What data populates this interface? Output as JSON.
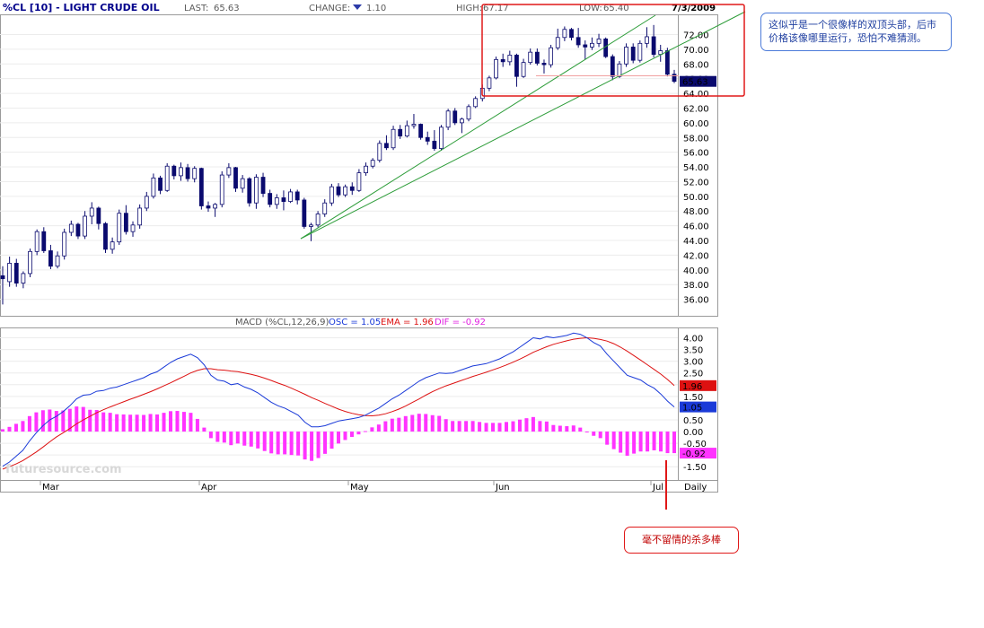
{
  "header": {
    "title": "%CL [10] - LIGHT CRUDE OIL",
    "last_label": "LAST:",
    "last": "65.63",
    "change_label": "CHANGE:",
    "change": "1.10",
    "high_label": "HIGH:",
    "high": "67.17",
    "low_label": "LOW:",
    "low": "65.40",
    "date": "7/3/2009"
  },
  "macd_header": {
    "prefix": "MACD (%CL,12,26,9)",
    "osc": "OSC = 1.05",
    "ema": "EMA = 1.96",
    "dif": "DIF = -0.92"
  },
  "watermark": "futuresource.com",
  "notes": {
    "top_right": "这似乎是一个很像样的双顶头部，后市价格该像哪里运行，恐怕不难猜测。",
    "bottom": "毫不留情的杀多棒"
  },
  "colors": {
    "up": "#ffffff",
    "down": "#0a0a6e",
    "macd_line": "#1a3ad8",
    "signal_line": "#dd1111",
    "histogram": "#ff33ff",
    "trendline": "#2e9d3a",
    "annotation": "#e01818"
  },
  "chart_data": [
    {
      "type": "candlestick",
      "title": "%CL [10] - LIGHT CRUDE OIL",
      "y_ticks": [
        "72.00",
        "70.00",
        "68.00",
        "66.00",
        "64.00",
        "62.00",
        "60.00",
        "58.00",
        "56.00",
        "54.00",
        "52.00",
        "50.00",
        "48.00",
        "46.00",
        "44.00",
        "42.00",
        "40.00",
        "38.00",
        "36.00"
      ],
      "ylim": [
        34.0,
        74.5
      ],
      "x_labels": [
        "Mar",
        "Apr",
        "May",
        "Jun",
        "Jul",
        "Daily"
      ],
      "last_price_label": "65.63",
      "candles": [
        [
          39.2,
          40.5,
          35.3,
          38.8
        ],
        [
          38.4,
          41.8,
          37.7,
          40.9
        ],
        [
          40.9,
          41.5,
          37.7,
          38.2
        ],
        [
          38.2,
          39.8,
          37.5,
          39.5
        ],
        [
          39.5,
          42.9,
          39.0,
          42.5
        ],
        [
          42.5,
          45.5,
          42.0,
          45.2
        ],
        [
          45.2,
          45.8,
          42.3,
          42.6
        ],
        [
          42.6,
          43.4,
          40.1,
          40.5
        ],
        [
          40.5,
          42.5,
          40.2,
          41.9
        ],
        [
          41.9,
          45.6,
          41.4,
          45.1
        ],
        [
          45.1,
          46.7,
          44.6,
          46.2
        ],
        [
          46.2,
          46.4,
          44.2,
          44.6
        ],
        [
          44.6,
          48.0,
          44.2,
          47.3
        ],
        [
          47.3,
          49.2,
          46.2,
          48.4
        ],
        [
          48.4,
          48.6,
          45.5,
          46.3
        ],
        [
          46.3,
          46.5,
          42.3,
          42.8
        ],
        [
          42.8,
          44.4,
          42.2,
          43.8
        ],
        [
          43.8,
          48.2,
          43.4,
          47.7
        ],
        [
          47.7,
          48.8,
          44.8,
          45.2
        ],
        [
          45.2,
          46.6,
          44.5,
          46.1
        ],
        [
          46.1,
          48.9,
          45.6,
          48.4
        ],
        [
          48.4,
          50.6,
          48.0,
          50.0
        ],
        [
          50.0,
          53.1,
          49.7,
          52.5
        ],
        [
          52.5,
          52.8,
          50.3,
          50.8
        ],
        [
          50.8,
          54.5,
          50.6,
          54.1
        ],
        [
          54.1,
          54.3,
          52.3,
          52.8
        ],
        [
          52.8,
          54.6,
          52.1,
          53.9
        ],
        [
          53.9,
          54.4,
          52.0,
          52.4
        ],
        [
          52.4,
          54.1,
          51.9,
          53.8
        ],
        [
          53.8,
          53.9,
          48.2,
          48.7
        ],
        [
          48.7,
          49.3,
          47.9,
          48.4
        ],
        [
          48.4,
          49.1,
          47.2,
          48.9
        ],
        [
          48.9,
          53.4,
          48.5,
          52.9
        ],
        [
          52.9,
          54.5,
          52.5,
          53.9
        ],
        [
          53.9,
          54.0,
          50.6,
          51.1
        ],
        [
          51.1,
          52.9,
          50.5,
          52.4
        ],
        [
          52.4,
          52.6,
          48.6,
          49.1
        ],
        [
          49.1,
          53.0,
          48.3,
          52.6
        ],
        [
          52.6,
          53.2,
          49.9,
          50.4
        ],
        [
          50.4,
          50.9,
          48.5,
          48.9
        ],
        [
          48.9,
          50.3,
          48.3,
          49.8
        ],
        [
          49.8,
          50.8,
          48.1,
          49.3
        ],
        [
          49.3,
          51.0,
          49.1,
          50.6
        ],
        [
          50.6,
          50.9,
          48.9,
          49.5
        ],
        [
          49.5,
          49.8,
          45.6,
          45.9
        ],
        [
          45.9,
          46.4,
          43.9,
          46.1
        ],
        [
          46.1,
          48.0,
          45.8,
          47.6
        ],
        [
          47.6,
          49.6,
          47.2,
          49.1
        ],
        [
          49.1,
          51.7,
          48.7,
          51.3
        ],
        [
          51.3,
          51.8,
          49.9,
          50.2
        ],
        [
          50.2,
          51.6,
          49.9,
          51.3
        ],
        [
          51.3,
          51.9,
          50.2,
          50.8
        ],
        [
          50.8,
          53.7,
          50.6,
          53.2
        ],
        [
          53.2,
          54.6,
          52.8,
          54.1
        ],
        [
          54.1,
          55.2,
          53.8,
          54.9
        ],
        [
          54.9,
          57.6,
          54.6,
          57.2
        ],
        [
          57.2,
          58.3,
          56.3,
          56.6
        ],
        [
          56.6,
          59.6,
          56.3,
          59.1
        ],
        [
          59.1,
          59.7,
          57.8,
          58.2
        ],
        [
          58.2,
          60.3,
          58.0,
          59.6
        ],
        [
          59.6,
          61.2,
          59.2,
          59.8
        ],
        [
          59.8,
          59.9,
          57.7,
          58.0
        ],
        [
          58.0,
          58.8,
          57.0,
          57.5
        ],
        [
          57.5,
          59.0,
          56.2,
          56.5
        ],
        [
          56.5,
          59.7,
          56.2,
          59.4
        ],
        [
          59.4,
          61.9,
          59.0,
          61.6
        ],
        [
          61.6,
          62.0,
          59.7,
          60.0
        ],
        [
          60.0,
          60.7,
          58.6,
          60.5
        ],
        [
          60.5,
          62.5,
          60.2,
          62.2
        ],
        [
          62.2,
          63.6,
          62.0,
          63.3
        ],
        [
          63.3,
          65.2,
          62.9,
          64.7
        ],
        [
          64.7,
          66.4,
          64.3,
          66.1
        ],
        [
          66.1,
          69.0,
          65.9,
          68.6
        ],
        [
          68.6,
          69.4,
          67.6,
          68.3
        ],
        [
          68.3,
          69.8,
          67.8,
          69.2
        ],
        [
          69.2,
          69.4,
          64.9,
          66.3
        ],
        [
          66.3,
          68.7,
          66.1,
          68.2
        ],
        [
          68.2,
          70.1,
          67.9,
          69.6
        ],
        [
          69.6,
          70.1,
          67.8,
          68.1
        ],
        [
          68.1,
          68.6,
          66.7,
          67.9
        ],
        [
          67.9,
          70.6,
          67.5,
          70.2
        ],
        [
          70.2,
          72.8,
          69.9,
          71.6
        ],
        [
          71.6,
          73.1,
          71.1,
          72.7
        ],
        [
          72.7,
          72.9,
          71.2,
          71.6
        ],
        [
          71.6,
          72.9,
          70.2,
          70.6
        ],
        [
          70.6,
          71.2,
          68.6,
          70.3
        ],
        [
          70.3,
          71.6,
          69.9,
          70.8
        ],
        [
          70.8,
          72.1,
          70.3,
          71.4
        ],
        [
          71.4,
          71.6,
          68.8,
          69.0
        ],
        [
          69.0,
          69.3,
          65.8,
          66.3
        ],
        [
          66.3,
          68.4,
          66.1,
          68.0
        ],
        [
          68.0,
          70.8,
          67.6,
          70.3
        ],
        [
          70.3,
          70.8,
          68.1,
          68.5
        ],
        [
          68.5,
          71.2,
          68.2,
          70.8
        ],
        [
          70.8,
          73.0,
          70.2,
          71.7
        ],
        [
          71.7,
          73.3,
          68.9,
          69.3
        ],
        [
          69.3,
          70.6,
          68.3,
          69.8
        ],
        [
          69.8,
          70.2,
          66.3,
          66.6
        ],
        [
          66.6,
          67.2,
          65.4,
          65.63
        ]
      ]
    },
    {
      "type": "macd",
      "y_ticks": [
        "4.00",
        "3.50",
        "3.00",
        "2.50",
        "2.00",
        "1.50",
        "1.00",
        "0.50",
        "0.00",
        "-0.50",
        "-1.00",
        "-1.50"
      ],
      "ylim": [
        -1.95,
        4.25
      ],
      "value_labels": {
        "ema": "1.96",
        "osc": "1.05",
        "dif": "-0.92"
      },
      "macd_line": [
        -1.48,
        -1.3,
        -1.05,
        -0.8,
        -0.4,
        -0.05,
        0.25,
        0.5,
        0.65,
        0.85,
        1.1,
        1.4,
        1.55,
        1.58,
        1.72,
        1.75,
        1.85,
        1.9,
        2.0,
        2.1,
        2.2,
        2.3,
        2.45,
        2.55,
        2.75,
        2.95,
        3.1,
        3.2,
        3.3,
        3.15,
        2.85,
        2.4,
        2.2,
        2.15,
        2.0,
        2.05,
        1.9,
        1.8,
        1.65,
        1.45,
        1.25,
        1.1,
        1.0,
        0.85,
        0.7,
        0.4,
        0.2,
        0.2,
        0.25,
        0.35,
        0.45,
        0.5,
        0.55,
        0.6,
        0.7,
        0.85,
        1.0,
        1.2,
        1.4,
        1.55,
        1.75,
        1.95,
        2.15,
        2.3,
        2.4,
        2.5,
        2.48,
        2.5,
        2.6,
        2.7,
        2.8,
        2.85,
        2.9,
        3.0,
        3.1,
        3.25,
        3.4,
        3.6,
        3.8,
        4.0,
        3.95,
        4.05,
        4.0,
        4.05,
        4.1,
        4.2,
        4.15,
        4.0,
        3.8,
        3.65,
        3.3,
        3.0,
        2.7,
        2.4,
        2.3,
        2.2,
        2.0,
        1.85,
        1.6,
        1.3,
        1.05
      ],
      "signal_line": [
        -1.6,
        -1.5,
        -1.38,
        -1.24,
        -1.06,
        -0.87,
        -0.66,
        -0.44,
        -0.23,
        -0.05,
        0.13,
        0.33,
        0.5,
        0.65,
        0.8,
        0.93,
        1.05,
        1.16,
        1.27,
        1.38,
        1.48,
        1.59,
        1.7,
        1.82,
        1.95,
        2.08,
        2.22,
        2.36,
        2.5,
        2.61,
        2.68,
        2.68,
        2.64,
        2.62,
        2.58,
        2.56,
        2.5,
        2.44,
        2.37,
        2.28,
        2.18,
        2.07,
        1.97,
        1.85,
        1.72,
        1.59,
        1.45,
        1.33,
        1.2,
        1.08,
        0.96,
        0.86,
        0.78,
        0.72,
        0.68,
        0.67,
        0.7,
        0.76,
        0.85,
        0.96,
        1.09,
        1.24,
        1.39,
        1.55,
        1.7,
        1.83,
        1.95,
        2.05,
        2.15,
        2.25,
        2.35,
        2.44,
        2.53,
        2.63,
        2.73,
        2.84,
        2.96,
        3.09,
        3.23,
        3.38,
        3.5,
        3.62,
        3.72,
        3.8,
        3.87,
        3.94,
        3.98,
        4.0,
        3.98,
        3.93,
        3.86,
        3.75,
        3.6,
        3.43,
        3.24,
        3.05,
        2.85,
        2.65,
        2.45,
        2.22,
        1.96
      ],
      "histogram": [
        0.1,
        0.2,
        0.33,
        0.45,
        0.66,
        0.82,
        0.91,
        0.94,
        0.88,
        0.9,
        0.97,
        1.07,
        1.05,
        0.93,
        0.92,
        0.82,
        0.8,
        0.74,
        0.73,
        0.72,
        0.72,
        0.71,
        0.75,
        0.73,
        0.8,
        0.87,
        0.88,
        0.84,
        0.8,
        0.54,
        0.17,
        -0.28,
        -0.44,
        -0.47,
        -0.58,
        -0.51,
        -0.6,
        -0.64,
        -0.72,
        -0.83,
        -0.93,
        -0.97,
        -0.97,
        -1.0,
        -1.02,
        -1.19,
        -1.25,
        -1.13,
        -0.95,
        -0.73,
        -0.51,
        -0.36,
        -0.23,
        -0.12,
        0.02,
        0.18,
        0.3,
        0.44,
        0.55,
        0.59,
        0.66,
        0.71,
        0.76,
        0.75,
        0.7,
        0.67,
        0.53,
        0.45,
        0.45,
        0.45,
        0.45,
        0.41,
        0.37,
        0.37,
        0.37,
        0.41,
        0.44,
        0.51,
        0.57,
        0.62,
        0.45,
        0.43,
        0.28,
        0.25,
        0.23,
        0.26,
        0.17,
        0.0,
        -0.18,
        -0.28,
        -0.56,
        -0.75,
        -0.9,
        -1.03,
        -0.94,
        -0.85,
        -0.85,
        -0.8,
        -0.85,
        -0.92,
        -0.92
      ]
    }
  ]
}
